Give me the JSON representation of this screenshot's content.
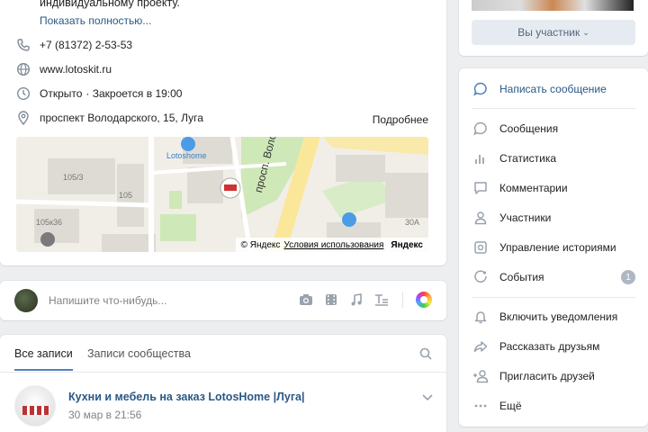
{
  "info": {
    "description_tail": "индивидуальному проекту.",
    "show_more": "Показать полностью...",
    "phone": "+7 (81372) 2-53-53",
    "website": "www.lotoskit.ru",
    "status_open": "Открыто",
    "status_close": "· Закроется в 19:00",
    "address": "проспект Володарского, 15, Луга",
    "details_link": "Подробнее"
  },
  "map": {
    "place_name": "Lotoshome",
    "street_label": "просп. Володарского",
    "house_numbers": [
      "105/3",
      "105",
      "105к36",
      "30А"
    ],
    "copyright": "© Яндекс",
    "terms": "Условия использования",
    "brand": "Яндекс"
  },
  "composer": {
    "placeholder": "Напишите что-нибудь..."
  },
  "wall": {
    "tabs": [
      "Все записи",
      "Записи сообщества"
    ],
    "post": {
      "title": "Кухни и мебель на заказ LotosHome |Луга|",
      "date": "30 мар в 21:56"
    }
  },
  "sidebar": {
    "member_button": "Вы участник",
    "items": [
      {
        "label": "Написать сообщение",
        "icon": "message-icon"
      },
      {
        "label": "Сообщения",
        "icon": "chat-icon"
      },
      {
        "label": "Статистика",
        "icon": "stats-icon"
      },
      {
        "label": "Комментарии",
        "icon": "comment-icon"
      },
      {
        "label": "Участники",
        "icon": "user-icon"
      },
      {
        "label": "Управление историями",
        "icon": "stories-icon"
      },
      {
        "label": "События",
        "icon": "events-icon"
      },
      {
        "label": "Включить уведомления",
        "icon": "bell-icon"
      },
      {
        "label": "Рассказать друзьям",
        "icon": "share-icon"
      },
      {
        "label": "Пригласить друзей",
        "icon": "invite-icon"
      },
      {
        "label": "Ещё",
        "icon": "more-icon"
      }
    ],
    "events_badge": "1"
  },
  "colors": {
    "accent": "#5181b8",
    "link": "#2a5885",
    "open_green": "#4bb34b",
    "background": "#edeef0"
  }
}
